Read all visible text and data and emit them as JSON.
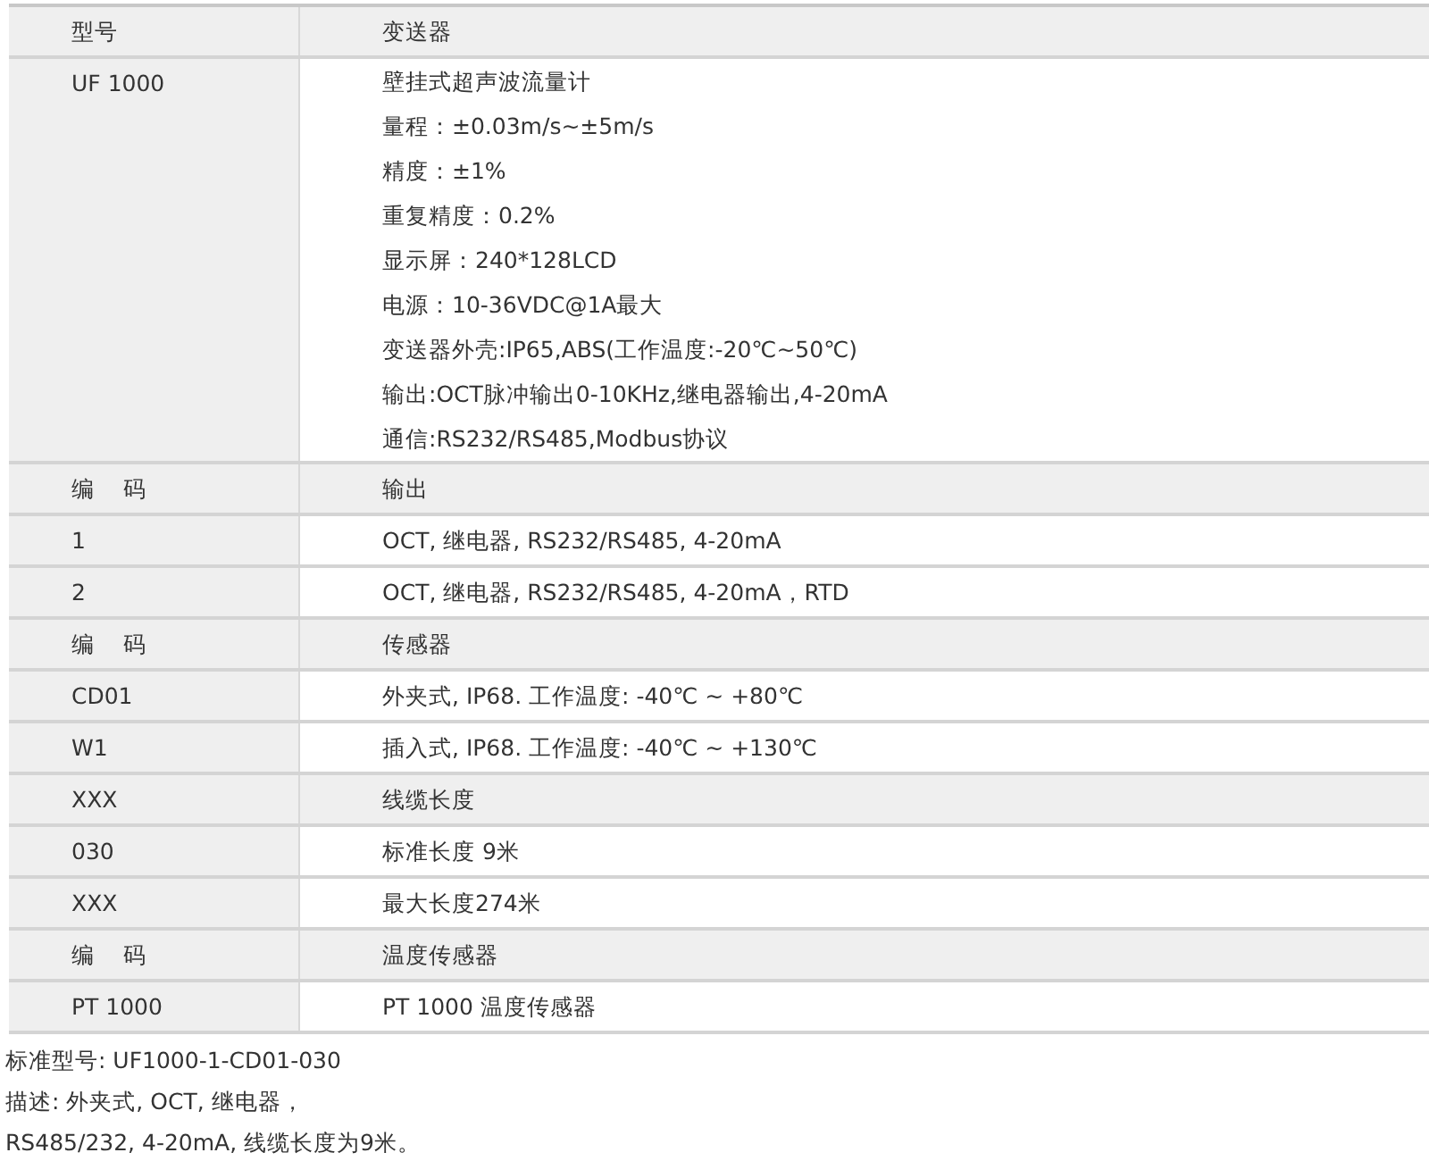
{
  "table": {
    "rows": [
      {
        "kind": "header",
        "code": "型号",
        "lines": [
          "变送器"
        ]
      },
      {
        "kind": "data",
        "code": "UF 1000",
        "lines": [
          "壁挂式超声波流量计",
          "量程：±0.03m/s~±5m/s",
          "精度：±1%",
          "重复精度：0.2%",
          "显示屏：240*128LCD",
          "电源：10-36VDC@1A最大",
          "变送器外壳:IP65,ABS(工作温度:-20℃~50℃)",
          "输出:OCT脉冲输出0-10KHz,继电器输出,4-20mA",
          "通信:RS232/RS485,Modbus协议"
        ]
      },
      {
        "kind": "header",
        "code": "编    码",
        "lines": [
          "输出"
        ]
      },
      {
        "kind": "data",
        "code": "1",
        "lines": [
          "OCT, 继电器, RS232/RS485, 4-20mA"
        ]
      },
      {
        "kind": "data",
        "code": "2",
        "lines": [
          "OCT, 继电器, RS232/RS485, 4-20mA，RTD"
        ]
      },
      {
        "kind": "header",
        "code": "编    码",
        "lines": [
          "传感器"
        ]
      },
      {
        "kind": "data",
        "code": "CD01",
        "lines": [
          "外夹式, IP68. 工作温度: -40℃ ~ +80℃"
        ]
      },
      {
        "kind": "data",
        "code": "W1",
        "lines": [
          "插入式, IP68. 工作温度: -40℃ ~ +130℃"
        ]
      },
      {
        "kind": "header",
        "code": "XXX",
        "lines": [
          "线缆长度"
        ]
      },
      {
        "kind": "data",
        "code": "030",
        "lines": [
          "标准长度 9米"
        ]
      },
      {
        "kind": "data",
        "code": "XXX",
        "lines": [
          "最大长度274米"
        ]
      },
      {
        "kind": "header",
        "code": "编    码",
        "lines": [
          "温度传感器"
        ]
      },
      {
        "kind": "data",
        "code": "PT 1000",
        "lines": [
          "PT 1000 温度传感器"
        ]
      }
    ]
  },
  "notes": [
    "标准型号: UF1000-1-CD01-030",
    "描述: 外夹式, OCT, 继电器，",
    "RS485/232, 4-20mA, 线缆长度为9米。"
  ]
}
